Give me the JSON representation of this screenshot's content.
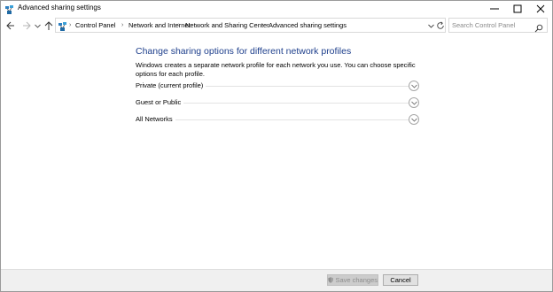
{
  "window": {
    "title": "Advanced sharing settings"
  },
  "address": {
    "crumbs": [
      "Control Panel",
      "Network and Internet",
      "Network and Sharing Center",
      "Advanced sharing settings"
    ]
  },
  "search": {
    "placeholder": "Search Control Panel"
  },
  "main": {
    "heading": "Change sharing options for different network profiles",
    "description": "Windows creates a separate network profile for each network you use. You can choose specific options for each profile.",
    "sections": [
      {
        "label": "Private (current profile)"
      },
      {
        "label": "Guest or Public"
      },
      {
        "label": "All Networks"
      }
    ]
  },
  "footer": {
    "save_label": "Save changes",
    "cancel_label": "Cancel"
  },
  "colors": {
    "heading": "#1e3f8c",
    "save_button_disabled_bg": "#cccccc",
    "footer_bg": "#f0f0f0"
  },
  "icons": {
    "app": "network-sharing-icon",
    "back": "back-arrow-icon",
    "forward": "forward-arrow-icon",
    "recent": "chevron-down-icon",
    "up": "up-arrow-icon",
    "dropdown": "chevron-down-icon",
    "refresh": "refresh-icon",
    "search": "search-icon",
    "expand": "chevron-down-circle-icon",
    "shield": "uac-shield-icon"
  }
}
